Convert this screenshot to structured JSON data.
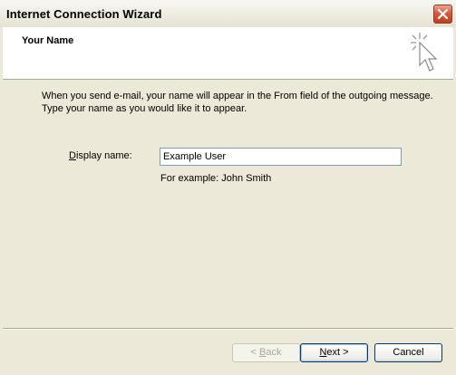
{
  "window": {
    "title": "Internet Connection Wizard"
  },
  "header": {
    "title": "Your Name",
    "icon": "wizard-cursor-icon"
  },
  "content": {
    "intro_line1": "When you send e-mail, your name will appear in the From field of the outgoing message.",
    "intro_line2": "Type your name as you would like it to appear.",
    "display_name_label_acc": "D",
    "display_name_label_rest": "isplay name:",
    "display_name_value": "Example User",
    "example_text": "For example: John Smith"
  },
  "buttons": {
    "back_prefix": "< ",
    "back_acc": "B",
    "back_rest": "ack",
    "next_acc": "N",
    "next_rest": "ext >",
    "cancel": "Cancel"
  }
}
